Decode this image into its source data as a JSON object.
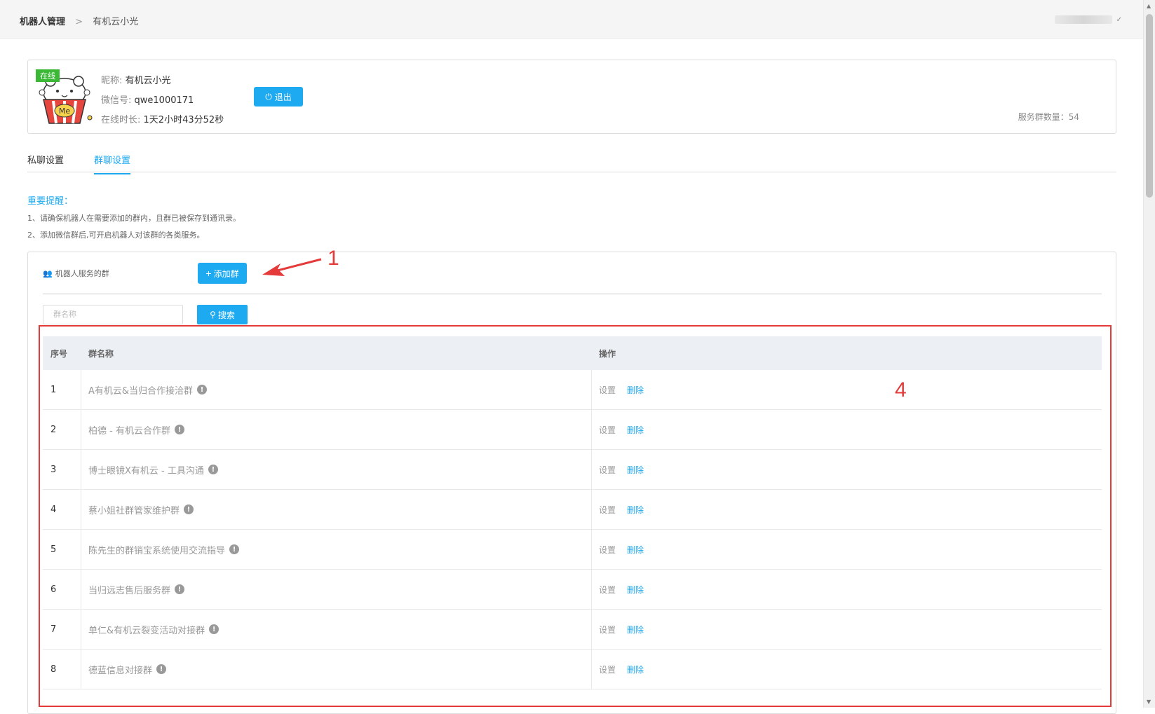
{
  "header": {
    "breadcrumb_root": "机器人管理",
    "breadcrumb_sep": ">",
    "breadcrumb_current": "有机云小光"
  },
  "profile": {
    "status_badge": "在线",
    "nickname_key": "昵称:",
    "nickname_value": "有机云小光",
    "wechat_key": "微信号:",
    "wechat_value": "qwe1000171",
    "online_key": "在线时长:",
    "online_value": "1天2小时43分52秒",
    "logout_label": "退出",
    "group_count": "服务群数量：54"
  },
  "tabs": [
    {
      "label": "私聊设置"
    },
    {
      "label": "群聊设置"
    }
  ],
  "notice": {
    "title": "重要提醒：",
    "lines": [
      "1、请确保机器人在需要添加的群内，且群已被保存到通讯录。",
      "2、添加微信群后,可开启机器人对该群的各类服务。"
    ]
  },
  "panel": {
    "title": "机器人服务的群",
    "add_label": "添加群",
    "search_placeholder": "群名称",
    "search_label": "搜索"
  },
  "table": {
    "headers": [
      "序号",
      "群名称",
      "操作"
    ],
    "action_set": "设置",
    "action_delete": "删除",
    "rows": [
      {
        "index": "1",
        "name": "A有机云&当归合作接洽群"
      },
      {
        "index": "2",
        "name": "柏德 - 有机云合作群"
      },
      {
        "index": "3",
        "name": "博士眼镜X有机云 - 工具沟通"
      },
      {
        "index": "4",
        "name": "蔡小姐社群管家维护群"
      },
      {
        "index": "5",
        "name": "陈先生的群销宝系统使用交流指导"
      },
      {
        "index": "6",
        "name": "当归远志售后服务群"
      },
      {
        "index": "7",
        "name": "单仁&有机云裂变活动对接群"
      },
      {
        "index": "8",
        "name": "德蓝信息对接群"
      }
    ]
  },
  "annotations": {
    "marker1": "1",
    "marker4": "4"
  },
  "colors": {
    "accent": "#1eaaf1",
    "online": "#3cb837",
    "annotation": "#e43a3a"
  }
}
